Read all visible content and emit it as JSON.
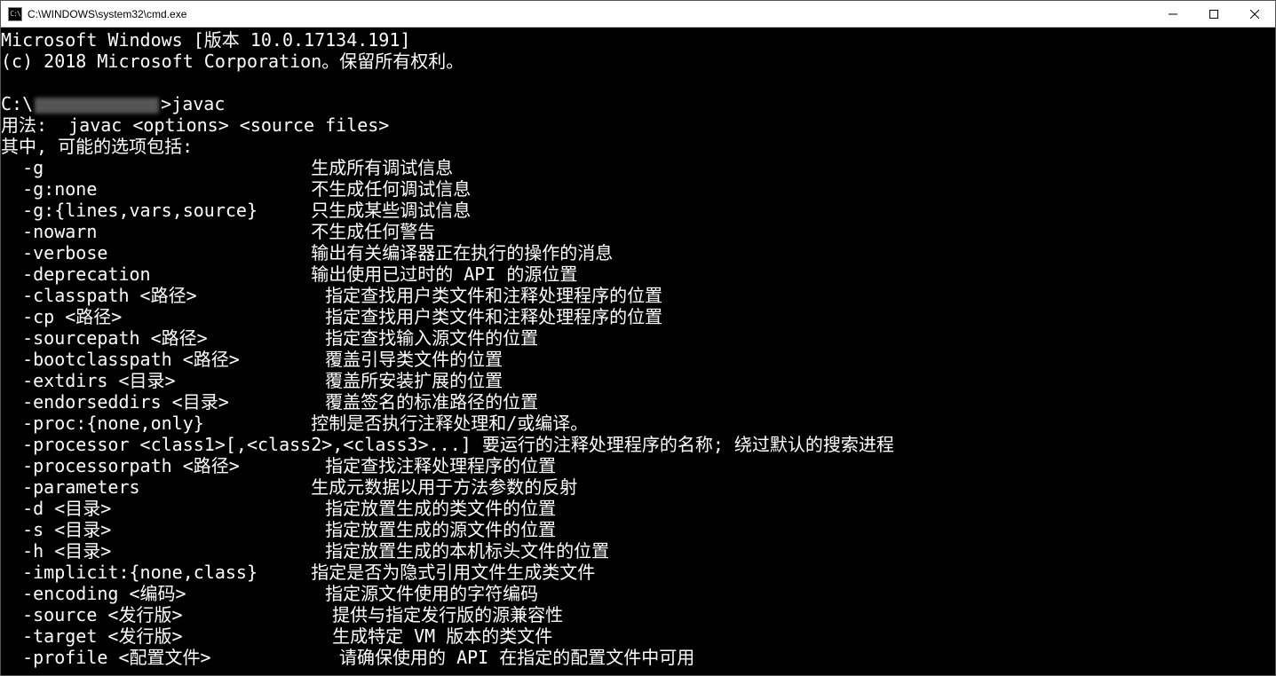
{
  "titlebar": {
    "icon_text": "C:\\",
    "title": "C:\\WINDOWS\\system32\\cmd.exe"
  },
  "terminal": {
    "header1": "Microsoft Windows [版本 10.0.17134.191]",
    "header2": "(c) 2018 Microsoft Corporation。保留所有权利。",
    "prompt_prefix": "C:\\",
    "prompt_suffix": ">javac",
    "usage": "用法:  javac <options> <source files>",
    "options_intro": "其中, 可能的选项包括:",
    "options": [
      {
        "flag": "  -g                         ",
        "desc": "生成所有调试信息"
      },
      {
        "flag": "  -g:none                    ",
        "desc": "不生成任何调试信息"
      },
      {
        "flag": "  -g:{lines,vars,source}     ",
        "desc": "只生成某些调试信息"
      },
      {
        "flag": "  -nowarn                    ",
        "desc": "不生成任何警告"
      },
      {
        "flag": "  -verbose                   ",
        "desc": "输出有关编译器正在执行的操作的消息"
      },
      {
        "flag": "  -deprecation               ",
        "desc": "输出使用已过时的 API 的源位置"
      },
      {
        "flag": "  -classpath <路径>            ",
        "desc": "指定查找用户类文件和注释处理程序的位置"
      },
      {
        "flag": "  -cp <路径>                   ",
        "desc": "指定查找用户类文件和注释处理程序的位置"
      },
      {
        "flag": "  -sourcepath <路径>           ",
        "desc": "指定查找输入源文件的位置"
      },
      {
        "flag": "  -bootclasspath <路径>        ",
        "desc": "覆盖引导类文件的位置"
      },
      {
        "flag": "  -extdirs <目录>              ",
        "desc": "覆盖所安装扩展的位置"
      },
      {
        "flag": "  -endorseddirs <目录>         ",
        "desc": "覆盖签名的标准路径的位置"
      },
      {
        "flag": "  -proc:{none,only}          ",
        "desc": "控制是否执行注释处理和/或编译。"
      },
      {
        "flag": "  -processor <class1>[,<class2>,<class3>...] ",
        "desc": "要运行的注释处理程序的名称; 绕过默认的搜索进程"
      },
      {
        "flag": "  -processorpath <路径>        ",
        "desc": "指定查找注释处理程序的位置"
      },
      {
        "flag": "  -parameters                ",
        "desc": "生成元数据以用于方法参数的反射"
      },
      {
        "flag": "  -d <目录>                    ",
        "desc": "指定放置生成的类文件的位置"
      },
      {
        "flag": "  -s <目录>                    ",
        "desc": "指定放置生成的源文件的位置"
      },
      {
        "flag": "  -h <目录>                    ",
        "desc": "指定放置生成的本机标头文件的位置"
      },
      {
        "flag": "  -implicit:{none,class}     ",
        "desc": "指定是否为隐式引用文件生成类文件"
      },
      {
        "flag": "  -encoding <编码>             ",
        "desc": "指定源文件使用的字符编码"
      },
      {
        "flag": "  -source <发行版>              ",
        "desc": "提供与指定发行版的源兼容性"
      },
      {
        "flag": "  -target <发行版>              ",
        "desc": "生成特定 VM 版本的类文件"
      },
      {
        "flag": "  -profile <配置文件>            ",
        "desc": "请确保使用的 API 在指定的配置文件中可用"
      }
    ]
  }
}
